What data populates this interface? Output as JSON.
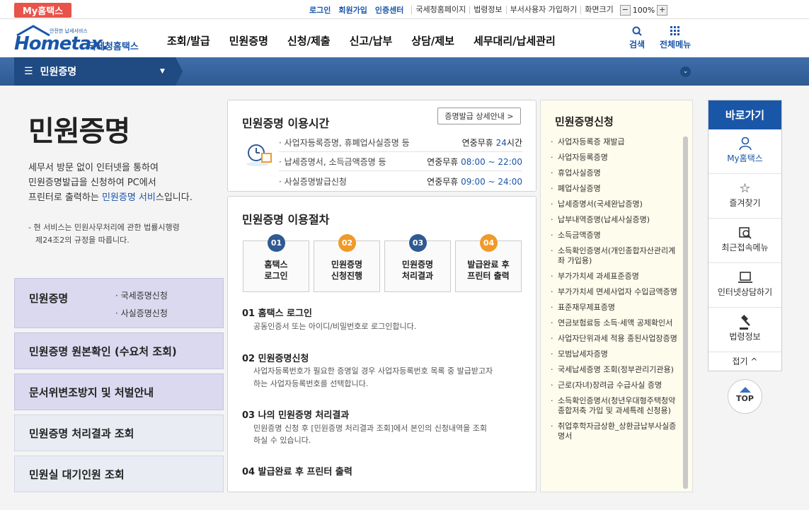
{
  "topbar": {
    "mytax": "My홈택스",
    "login": "로그인",
    "join": "회원가입",
    "cert": "인증센터",
    "links": [
      "국세청홈페이지",
      "법령정보",
      "부서사용자 가입하기",
      "화면크기"
    ],
    "zoom_minus": "−",
    "zoom": "100%",
    "zoom_plus": "+"
  },
  "header": {
    "logo_small": "안전한 납세서비스",
    "logo_main": "Hometax.",
    "logo_kr": "국세청홈택스",
    "menu": [
      "조회/발급",
      "민원증명",
      "신청/제출",
      "신고/납부",
      "상담/제보",
      "세무대리/납세관리"
    ],
    "search": "검색",
    "allmenu": "전체메뉴"
  },
  "bar": {
    "label": "민원증명",
    "menu_icon": "hamburger-icon",
    "down_icon": "chevron-down-icon"
  },
  "page": {
    "title": "민원증명",
    "desc1": "세무서 방문 없이 인터넷을 통하여",
    "desc2": "민원증명발급을 신청하여 PC에서",
    "desc3a": "프린터로 출력하는 ",
    "desc3b": "민원증명 서비",
    "desc3c": "스입니다.",
    "note1": "- 현 서비스는 민원사무처리에 관한 법률시행령",
    "note2": "제24조2의 규정을 따릅니다."
  },
  "left": {
    "box1": "민원증명",
    "box1_sub1": "· 국세증명신청",
    "box1_sub2": "· 사실증명신청",
    "box2": "민원증명 원본확인 (수요처 조회)",
    "box3": "문서위변조방지 및 처벌안내",
    "box4": "민원증명 처리결과 조회",
    "box5": "민원실 대기인원 조회"
  },
  "hours": {
    "title": "민원증명 이용시간",
    "detail_btn": "증명발급 상세안내 >",
    "rows": [
      {
        "name": "· 사업자등록증명, 휴폐업사실증명 등",
        "pre": "연중무휴 ",
        "val": "24",
        "post": "시간"
      },
      {
        "name": "· 납세증명서, 소득금액증명 등",
        "pre": "연중무휴 ",
        "val": "08:00 ~ 22:00",
        "post": ""
      },
      {
        "name": "· 사실증명발급신청",
        "pre": "연중무휴 ",
        "val": "09:00 ~ 24:00",
        "post": ""
      }
    ]
  },
  "proc": {
    "title": "민원증명 이용절차",
    "steps": [
      {
        "num": "01",
        "l1": "홈택스",
        "l2": "로그인",
        "color": "#2f5a92"
      },
      {
        "num": "02",
        "l1": "민원증명",
        "l2": "신청진행",
        "color": "#f09a2a"
      },
      {
        "num": "03",
        "l1": "민원증명",
        "l2": "처리결과",
        "color": "#2f5a92"
      },
      {
        "num": "04",
        "l1": "발급완료 후",
        "l2": "프린터 출력",
        "color": "#f09a2a"
      }
    ],
    "items": [
      {
        "h": "01 홈택스 로그인",
        "t1": "공동인증서 또는 아이디/비밀번호로 로그인합니다.",
        "t2": ""
      },
      {
        "h": "02 민원증명신청",
        "t1": "사업자등록번호가 필요한 증명일 경우 사업자등록번호 목록 중 발급받고자",
        "t2": "하는 사업자등록번호를 선택합니다."
      },
      {
        "h": "03 나의 민원증명 처리결과",
        "t1": "민원증명 신청 후 [민원증명 처리결과 조회]에서 본인의 신청내역을 조회",
        "t2": "하실 수 있습니다."
      },
      {
        "h": "04 발급완료 후 프린터 출력",
        "t1": "",
        "t2": ""
      }
    ]
  },
  "apply": {
    "title": "민원증명신청",
    "items": [
      "사업자등록증 재발급",
      "사업자등록증명",
      "휴업사실증명",
      "폐업사실증명",
      "납세증명서(국세완납증명)",
      "납부내역증명(납세사실증명)",
      "소득금액증명",
      "소득확인증명서(개인종합자산관리계좌 가입용)",
      "부가가치세 과세표준증명",
      "부가가치세 면세사업자 수입금액증명",
      "표준재무제표증명",
      "연금보험료등 소득·세액 공제확인서",
      "사업자단위과세 적용 종된사업장증명",
      "모범납세자증명",
      "국세납세증명 조회(정부관리기관용)",
      "근로(자녀)장려금 수급사실 증명",
      "소득확인증명서(청년우대형주택청약종합저축 가입 및 과세특례 신청용)",
      "취업후학자금상환_상환금납부사실증명서"
    ]
  },
  "quick": {
    "title": "바로가기",
    "items": [
      {
        "label": "My홈택스",
        "icon": "user-icon"
      },
      {
        "label": "즐겨찾기",
        "icon": "star-icon"
      },
      {
        "label": "최근접속메뉴",
        "icon": "recent-search-icon"
      },
      {
        "label": "인터넷상담하기",
        "icon": "laptop-icon"
      },
      {
        "label": "법령정보",
        "icon": "gavel-icon"
      }
    ],
    "fold": "접기 ^"
  },
  "top_btn": "TOP"
}
